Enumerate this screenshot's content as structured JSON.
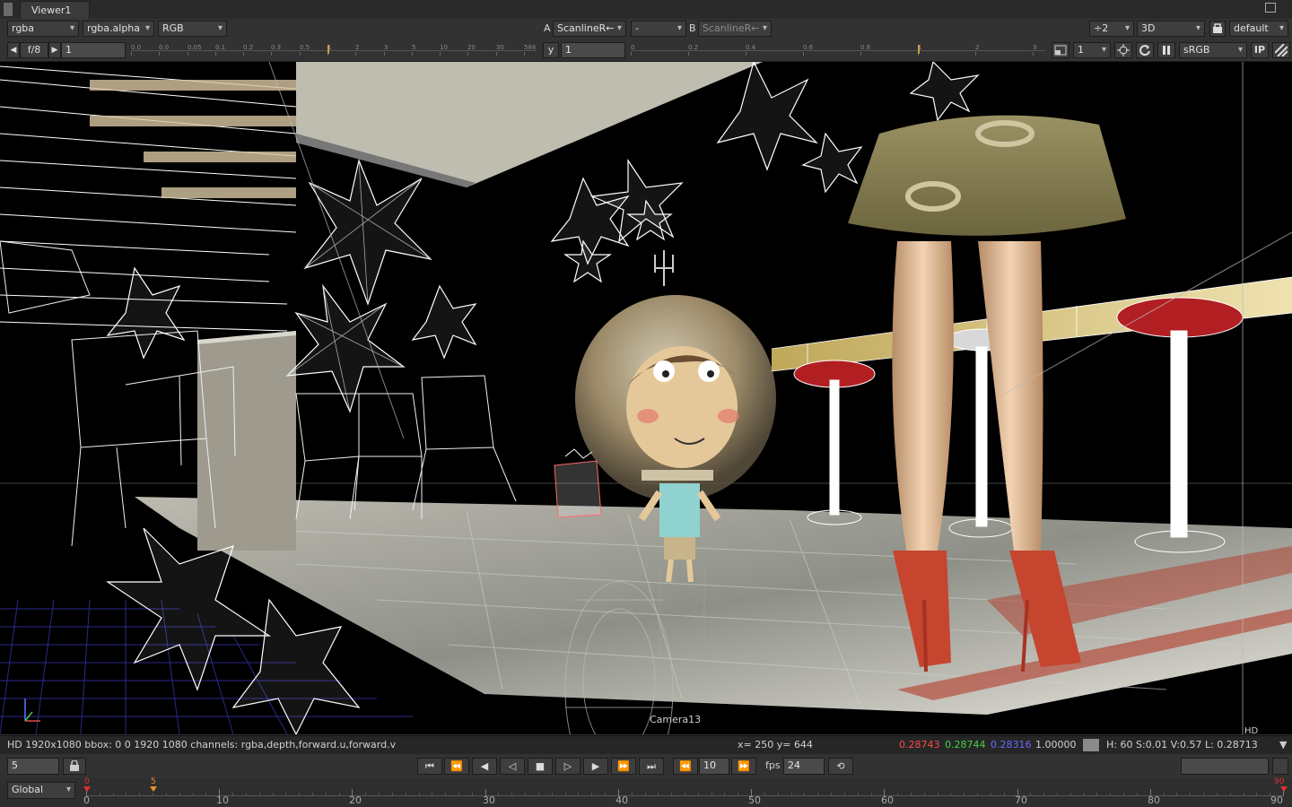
{
  "tab": {
    "title": "Viewer1"
  },
  "toolbar1": {
    "channels": "rgba",
    "alpha": "rgba.alpha",
    "display": "RGB",
    "input_a_label": "A",
    "input_a": "ScanlineR←",
    "compare": "-",
    "input_b_label": "B",
    "input_b": "ScanlineR←",
    "downscale": "÷2",
    "view_mode": "3D",
    "lut_preset": "default"
  },
  "toolbar2": {
    "fstop": "f/8",
    "gain": "1",
    "gain_ticks": [
      "0.0",
      "0.0",
      "0.05",
      "0.1",
      "0.2",
      "0.3",
      "0.5",
      "1",
      "2",
      "3",
      "5",
      "10",
      "20",
      "30",
      "584"
    ],
    "gamma_label": "y",
    "gamma": "1",
    "gamma_ticks": [
      "0",
      "0.2",
      "0.4",
      "0.6",
      "0.8",
      "1",
      "2",
      "3"
    ],
    "proxy": "1",
    "colorspace": "sRGB",
    "ip_label": "IP"
  },
  "viewport": {
    "camera_label": "Camera13",
    "format_label": "HD"
  },
  "infobar": {
    "format": "HD 1920x1080 bbox: 0 0 1920 1080 channels: rgba,depth,forward.u,forward.v",
    "coords": "x= 250 y= 644",
    "r": "0.28743",
    "g": "0.28744",
    "b": "0.28316",
    "a": "1.00000",
    "hsvl": "H: 60 S:0.01 V:0.57  L: 0.28713",
    "colors": {
      "r": "#ff4a4a",
      "g": "#46d046",
      "b": "#6a6aff"
    }
  },
  "playback": {
    "frame": "5",
    "increment": "10",
    "fps_label": "fps",
    "fps": "24"
  },
  "timeline": {
    "scope": "Global",
    "start": 0,
    "end": 90,
    "current": 5,
    "labels": [
      "0",
      "10",
      "20",
      "30",
      "40",
      "50",
      "60",
      "70",
      "80",
      "90"
    ],
    "start_marker": "0",
    "current_marker": "5",
    "end_marker": "90"
  }
}
